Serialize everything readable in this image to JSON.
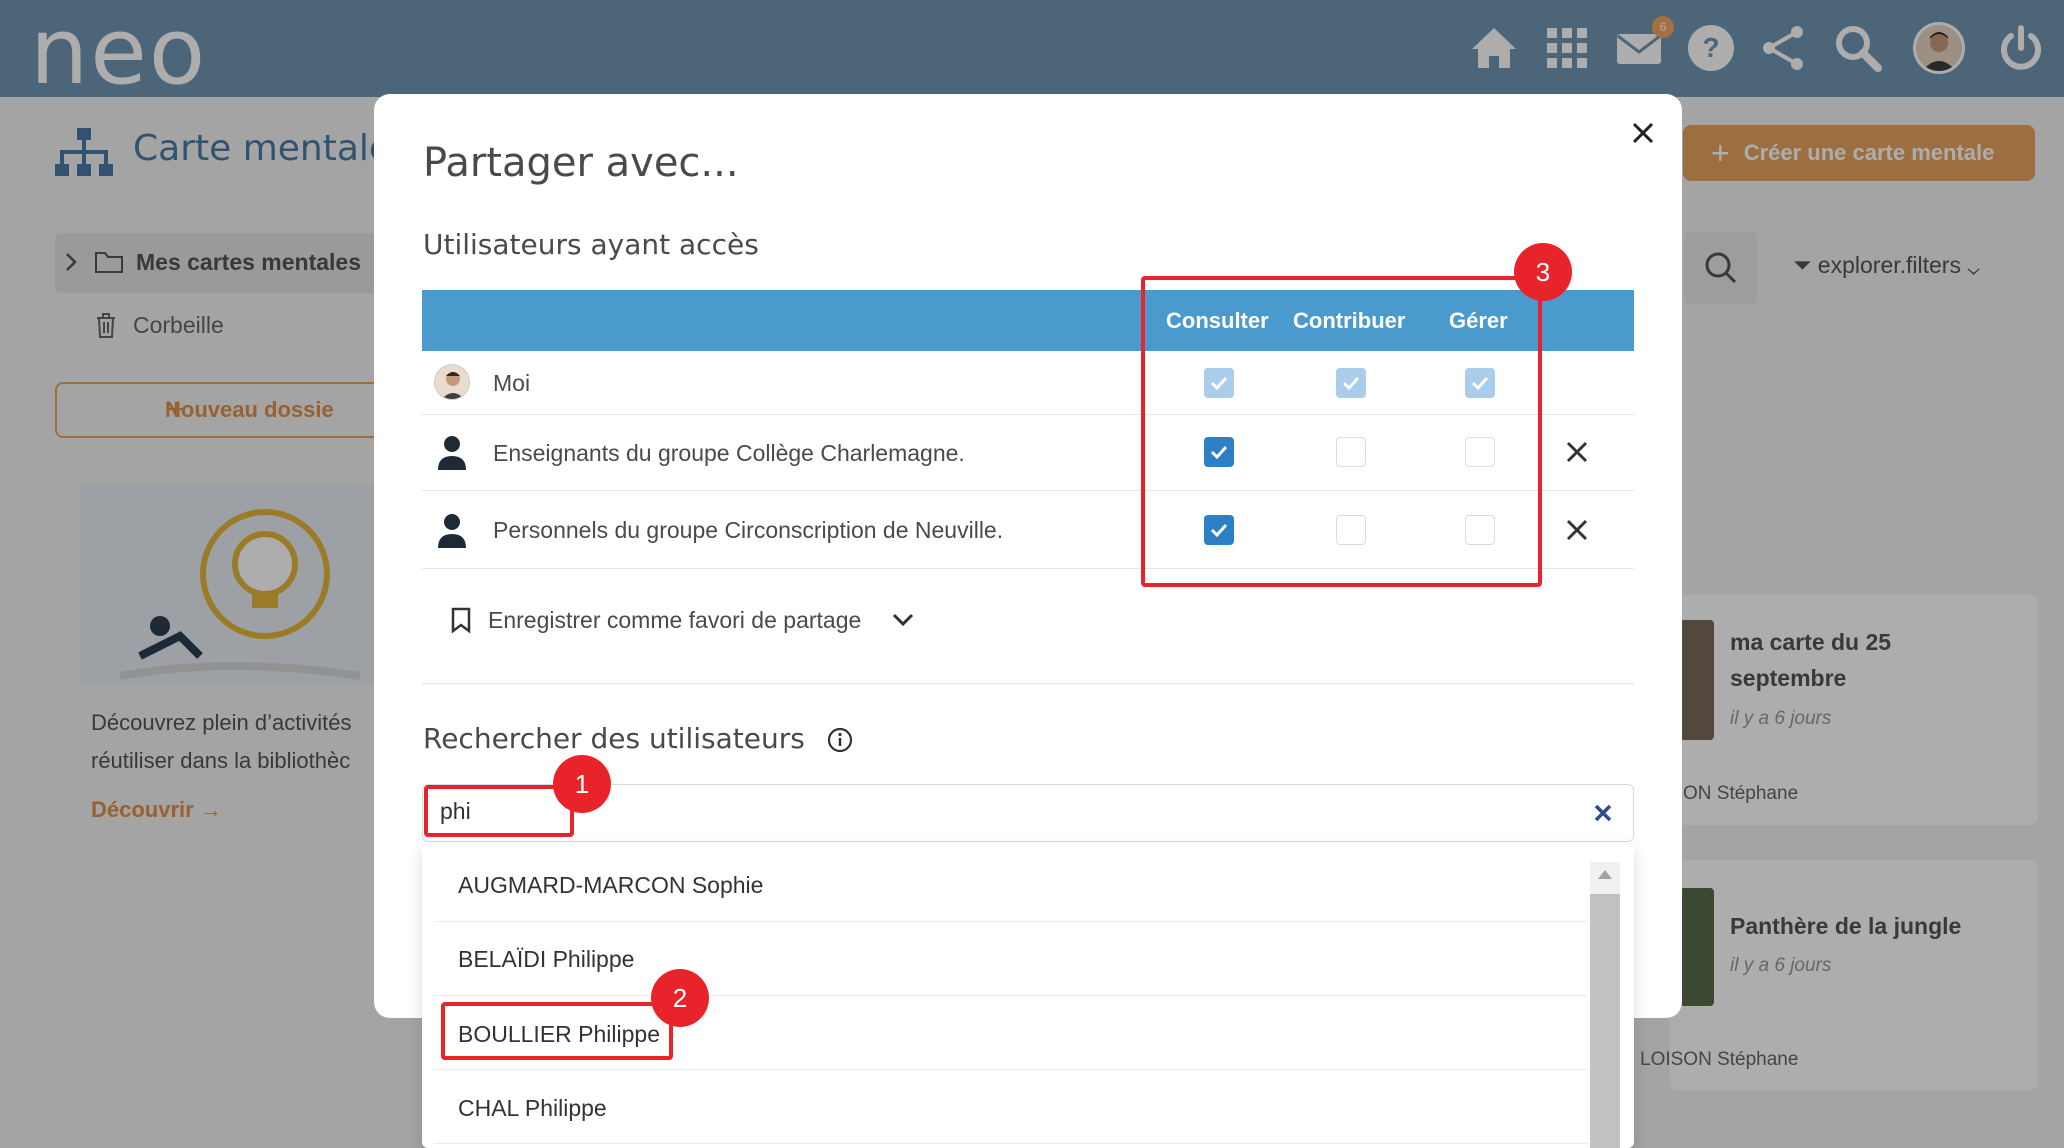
{
  "app": {
    "logo": "neo",
    "title": "Carte mentale",
    "create_button": "Créer une carte mentale",
    "mail_badge": "6",
    "nav_icons": [
      "home-icon",
      "apps-grid-icon",
      "mail-icon",
      "help-icon",
      "share-icon",
      "search-icon",
      "user-avatar",
      "power-icon"
    ]
  },
  "sidebar": {
    "folder": "Mes cartes mentales",
    "trash": "Corbeille",
    "new_folder": "Nouveau dossie"
  },
  "discover": {
    "text": "Découvrez plein d’activités réutiliser dans la bibliothèc",
    "link": "Découvrir"
  },
  "toolbar": {
    "filters": "explorer.filters"
  },
  "cards": [
    {
      "title": "ma carte du 25 septembre",
      "date": "il y a 6 jours",
      "owner": "ON Stéphane"
    },
    {
      "title": "Panthère de la jungle",
      "date": "il y a 6 jours",
      "owner": "LOISON Stéphane"
    }
  ],
  "modal": {
    "title": "Partager avec...",
    "access_title": "Utilisateurs ayant accès",
    "columns": [
      "Consulter",
      "Contribuer",
      "Gérer"
    ],
    "rows": [
      {
        "label": "Moi",
        "consulter": true,
        "contribuer": true,
        "gerer": true,
        "disabled": true
      },
      {
        "label": "Enseignants du groupe Collège Charlemagne.",
        "consulter": true,
        "contribuer": false,
        "gerer": false
      },
      {
        "label": "Personnels du groupe Circonscription de Neuville.",
        "consulter": true,
        "contribuer": false,
        "gerer": false
      }
    ],
    "favorite": "Enregistrer comme favori de partage",
    "search_title": "Rechercher des utilisateurs",
    "search_value": "phi",
    "results": [
      "AUGMARD-MARCON Sophie",
      "BELAÏDI Philippe",
      "BOULLIER Philippe",
      "CHAL Philippe"
    ]
  },
  "annotations": [
    "1",
    "2",
    "3"
  ],
  "colors": {
    "topbar": "#7295b3",
    "accent": "#e7a35d",
    "table_header": "#4a9acd",
    "checkbox": "#2e80c6",
    "annotation": "#e8232a"
  }
}
